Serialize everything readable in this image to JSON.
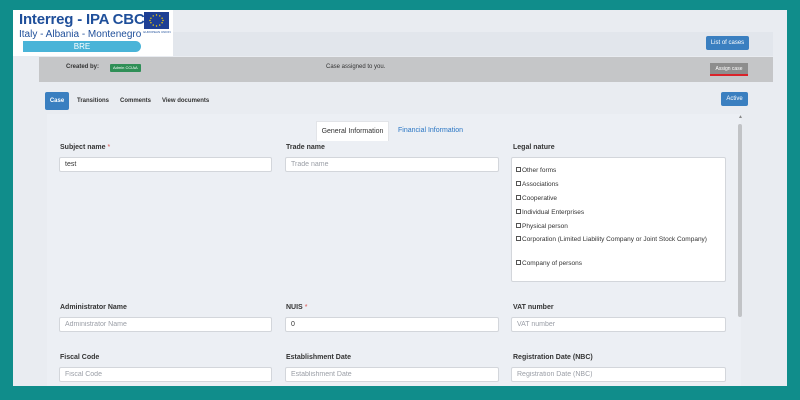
{
  "logo": {
    "title": "Interreg - IPA CBC",
    "subtitle": "Italy - Albania - Montenegro",
    "program": "BRE",
    "eu_caption": "EUROPEAN UNION"
  },
  "header": {
    "list_cases_label": "List of cases"
  },
  "created_bar": {
    "created_by_label": "Created by:",
    "creator": "Admin CCIAA",
    "assigned_message": "Case assigned to you.",
    "assign_button": "Assign case"
  },
  "tabs": [
    {
      "label": "Case"
    },
    {
      "label": "Transitions"
    },
    {
      "label": "Comments"
    },
    {
      "label": "View documents"
    }
  ],
  "status_button": "Active",
  "subtabs": [
    {
      "label": "General Information"
    },
    {
      "label": "Financial Information"
    }
  ],
  "form": {
    "subject_name": {
      "label": "Subject name",
      "required_mark": "*",
      "value": "test"
    },
    "trade_name": {
      "label": "Trade name",
      "placeholder": "Trade name"
    },
    "legal_nature": {
      "label": "Legal nature",
      "options": [
        "Other forms",
        "Associations",
        "Cooperative",
        "Individual Enterprises",
        "Physical person",
        "Corporation (Limited Liability Company or Joint Stock Company)",
        "Company of persons"
      ]
    },
    "administrator_name": {
      "label": "Administrator Name",
      "placeholder": "Administrator Name"
    },
    "nuis": {
      "label": "NUIS",
      "required_mark": "*",
      "value": "0"
    },
    "vat_number": {
      "label": "VAT number",
      "placeholder": "VAT number"
    },
    "fiscal_code": {
      "label": "Fiscal Code",
      "placeholder": "Fiscal Code"
    },
    "establishment_date": {
      "label": "Establishment Date",
      "placeholder": "Establishment Date"
    },
    "registration_date": {
      "label": "Registration Date (NBC)",
      "placeholder": "Registration Date (NBC)"
    }
  },
  "colors": {
    "frame": "#108d8b",
    "primary": "#3a7fc0",
    "assign_underline": "#d9232a",
    "badge": "#2f8f57"
  }
}
